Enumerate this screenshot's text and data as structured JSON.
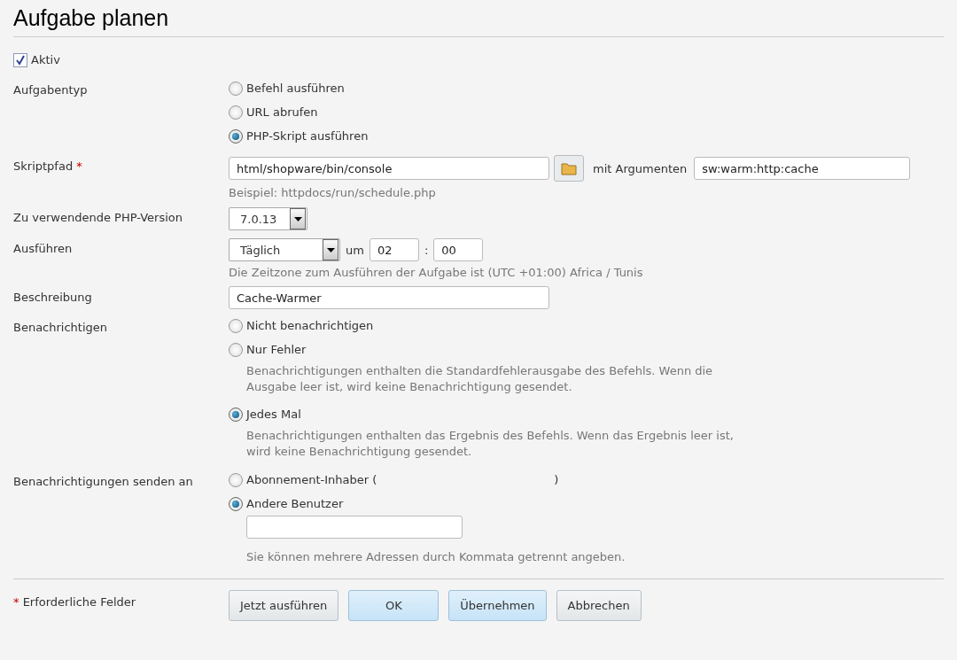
{
  "title": "Aufgabe planen",
  "active": {
    "label": "Aktiv",
    "checked": true
  },
  "task_type": {
    "label": "Aufgabentyp",
    "options": [
      {
        "label": "Befehl ausführen",
        "selected": false
      },
      {
        "label": "URL abrufen",
        "selected": false
      },
      {
        "label": "PHP-Skript ausführen",
        "selected": true
      }
    ]
  },
  "script_path": {
    "label": "Skriptpfad",
    "required_mark": "*",
    "value": "html/shopware/bin/console",
    "args_label": "mit Argumenten",
    "args_value": "sw:warm:http:cache",
    "hint": "Beispiel: httpdocs/run/schedule.php"
  },
  "php_version": {
    "label": "Zu verwendende PHP-Version",
    "value": "7.0.13"
  },
  "run": {
    "label": "Ausführen",
    "frequency": "Täglich",
    "at_label": "um",
    "hour": "02",
    "separator": ":",
    "minute": "00",
    "hint": "Die Zeitzone zum Ausführen der Aufgabe ist (UTC +01:00) Africa / Tunis"
  },
  "description": {
    "label": "Beschreibung",
    "value": "Cache-Warmer"
  },
  "notify": {
    "label": "Benachrichtigen",
    "options": [
      {
        "label": "Nicht benachrichtigen",
        "selected": false
      },
      {
        "label": "Nur Fehler",
        "selected": false,
        "hint": "Benachrichtigungen enthalten die Standardfehlerausgabe des Befehls. Wenn die Ausgabe leer ist, wird keine Benachrichtigung gesendet."
      },
      {
        "label": "Jedes Mal",
        "selected": true,
        "hint": "Benachrichtigungen enthalten das Ergebnis des Befehls. Wenn das Ergebnis leer ist, wird keine Benachrichtigung gesendet."
      }
    ]
  },
  "send_to": {
    "label": "Benachrichtigungen senden an",
    "options": [
      {
        "kind": "owner",
        "label": "Abonnement-Inhaber (",
        "closing": ")",
        "selected": false
      },
      {
        "kind": "other",
        "label": "Andere Benutzer",
        "selected": true,
        "hint": "Sie können mehrere Adressen durch Kommata getrennt angeben."
      }
    ]
  },
  "footer": {
    "required_mark": "*",
    "required_label": "Erforderliche Felder",
    "buttons": [
      {
        "label": "Jetzt ausführen",
        "kind": "default"
      },
      {
        "label": "OK",
        "kind": "primary"
      },
      {
        "label": "Übernehmen",
        "kind": "primary"
      },
      {
        "label": "Abbrechen",
        "kind": "default"
      }
    ]
  }
}
